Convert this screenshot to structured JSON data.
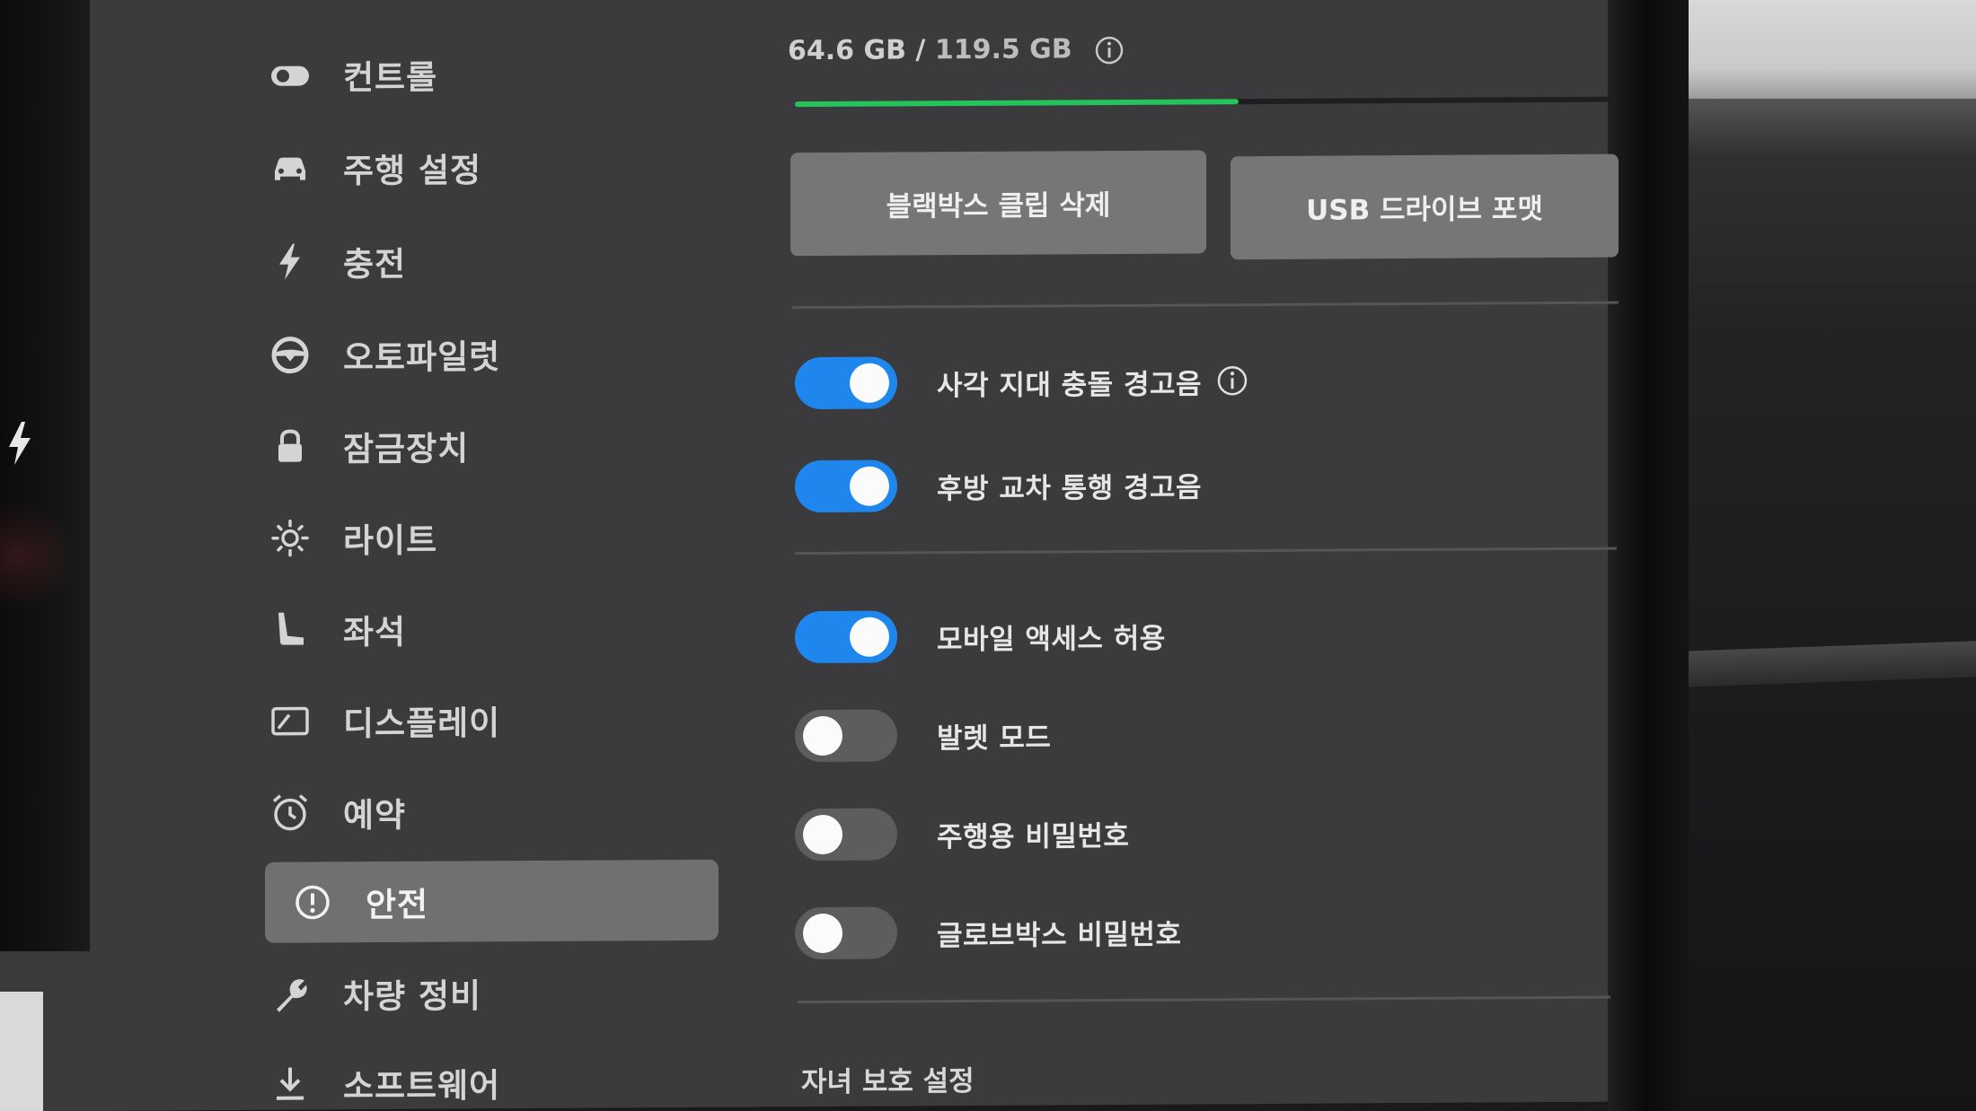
{
  "colors": {
    "toggle_on": "#1e86ec",
    "toggle_off": "#5d5d60",
    "storage_bar": "#24c45a",
    "active_nav": "#707072",
    "screen_bg": "#3b3b3d"
  },
  "sidebar": {
    "items": [
      {
        "label": "컨트롤",
        "icon": "toggle-icon",
        "active": false
      },
      {
        "label": "주행 설정",
        "icon": "car-icon",
        "active": false
      },
      {
        "label": "충전",
        "icon": "lightning-icon",
        "active": false
      },
      {
        "label": "오토파일럿",
        "icon": "steering-wheel-icon",
        "active": false
      },
      {
        "label": "잠금장치",
        "icon": "lock-icon",
        "active": false
      },
      {
        "label": "라이트",
        "icon": "sun-icon",
        "active": false
      },
      {
        "label": "좌석",
        "icon": "seat-icon",
        "active": false
      },
      {
        "label": "디스플레이",
        "icon": "display-icon",
        "active": false
      },
      {
        "label": "예약",
        "icon": "alarm-clock-icon",
        "active": false
      },
      {
        "label": "안전",
        "icon": "alert-circle-icon",
        "active": true
      },
      {
        "label": "차량 정비",
        "icon": "wrench-icon",
        "active": false
      },
      {
        "label": "소프트웨어",
        "icon": "download-icon",
        "active": false
      }
    ]
  },
  "storage": {
    "used": "64.6 GB",
    "separator": "/",
    "total": "119.5 GB",
    "used_fraction": 0.54
  },
  "buttons": {
    "delete_clips": "블랙박스 클립 삭제",
    "format_usb": "USB 드라이브 포맷"
  },
  "toggles": [
    {
      "label": "사각 지대 충돌 경고음",
      "on": true,
      "info": true
    },
    {
      "label": "후방 교차 통행 경고음",
      "on": true,
      "info": false
    },
    {
      "label": "모바일 액세스 허용",
      "on": true,
      "info": false
    },
    {
      "label": "발렛 모드",
      "on": false,
      "info": false
    },
    {
      "label": "주행용 비밀번호",
      "on": false,
      "info": false
    },
    {
      "label": "글로브박스 비밀번호",
      "on": false,
      "info": false
    }
  ],
  "sections": {
    "parental_controls": "자녀 보호 설정"
  }
}
